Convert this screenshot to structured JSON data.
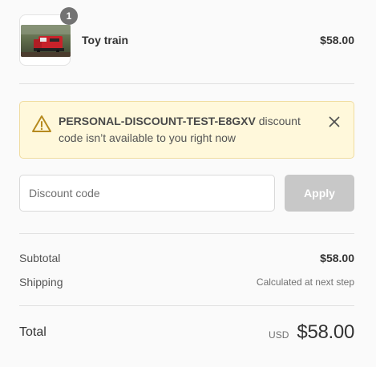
{
  "line_item": {
    "quantity": "1",
    "name": "Toy train",
    "price": "$58.00"
  },
  "notice": {
    "code": "PERSONAL-DISCOUNT-TEST-E8GXV",
    "message": " discount code isn’t available to you right now"
  },
  "discount": {
    "placeholder": "Discount code",
    "value": "",
    "apply_label": "Apply"
  },
  "summary": {
    "subtotal_label": "Subtotal",
    "subtotal_value": "$58.00",
    "shipping_label": "Shipping",
    "shipping_value": "Calculated at next step",
    "total_label": "Total",
    "currency": "USD",
    "total_value": "$58.00"
  },
  "colors": {
    "warning_bg": "#fff8db",
    "warning_icon": "#b68a1f",
    "apply_disabled": "#c8c8c8",
    "badge": "#737373"
  }
}
